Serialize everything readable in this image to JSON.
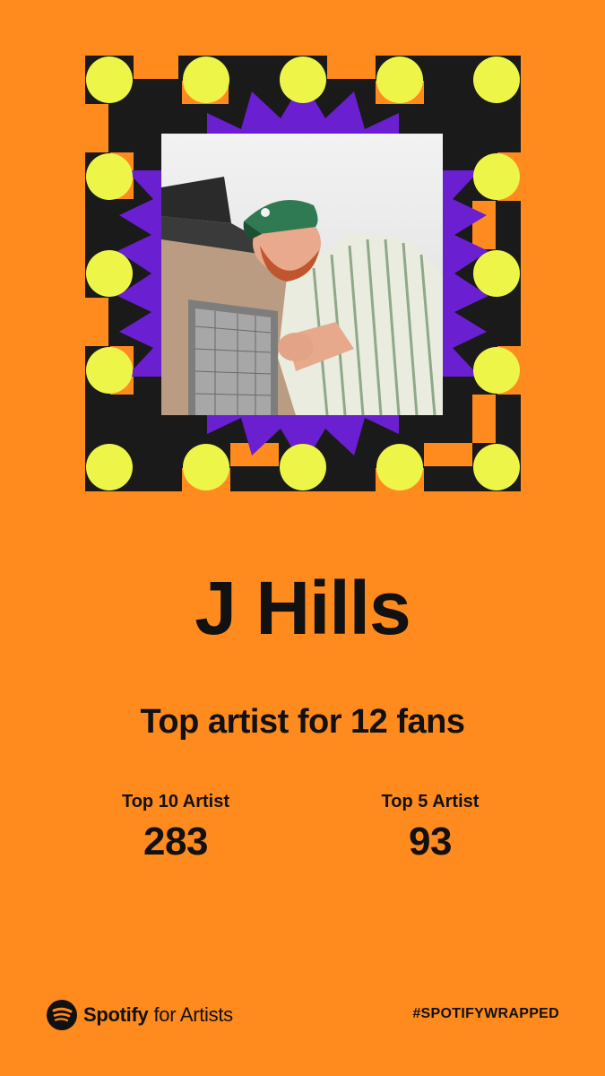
{
  "artist": {
    "name": "J Hills",
    "photo_alt": "Artist photo"
  },
  "headline": "Top artist for 12 fans",
  "stats": [
    {
      "label": "Top 10 Artist",
      "value": "283"
    },
    {
      "label": "Top 5 Artist",
      "value": "93"
    }
  ],
  "footer": {
    "brand": "Spotify",
    "brand_sub": "for Artists",
    "hashtag": "#SPOTIFYWRAPPED"
  },
  "colors": {
    "background": "#ff8a1e",
    "frame_black": "#1a1a1a",
    "frame_dots": "#eef549",
    "starburst": "#6a1fd1",
    "text": "#111111"
  }
}
